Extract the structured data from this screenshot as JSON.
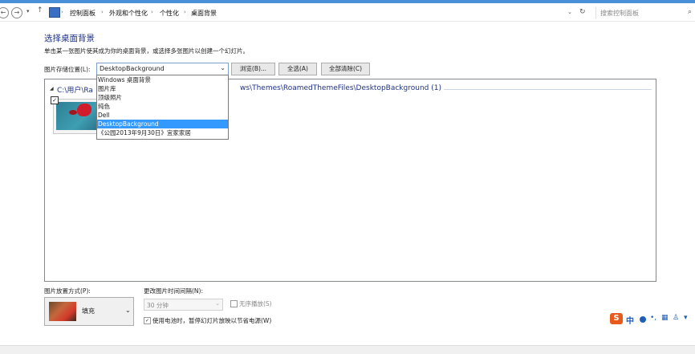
{
  "colors": {
    "accent": "#1e3287",
    "selection": "#3399ff",
    "title_strip": "#4a90d9"
  },
  "address_bar": {
    "back_icon": "back-arrow-icon",
    "forward_icon": "forward-arrow-icon",
    "dropdown_icon": "chevron-down-icon",
    "up_icon": "up-arrow-icon",
    "breadcrumbs": [
      "控制面板",
      "外观和个性化",
      "个性化",
      "桌面背景"
    ],
    "refresh_icon": "refresh-icon",
    "search_placeholder": "搜索控制面板"
  },
  "main": {
    "title": "选择桌面背景",
    "subtitle": "单击某一张图片使其成为你的桌面背景，或选择多张图片以创建一个幻灯片。",
    "location_label": "图片存储位置(L):",
    "location_value": "DesktopBackground",
    "buttons": {
      "browse": "浏览(B)...",
      "select_all": "全选(A)",
      "clear_all": "全部清除(C)"
    },
    "dropdown_options": [
      "Windows 桌面背景",
      "图片库",
      "顶级照片",
      "纯色",
      "Dell",
      "DesktopBackground",
      "《公园2013年9月30日》宜家家居"
    ],
    "dropdown_selected_index": 5,
    "group_path_left": "C:\\用户\\Ra",
    "group_path_right": "ws\\Themes\\RoamedThemeFiles\\DesktopBackground (1)",
    "thumbnail_checked": "✓"
  },
  "bottom": {
    "position_label": "图片放置方式(P):",
    "position_value": "填充",
    "interval_label": "更改图片时间间隔(N):",
    "interval_value": "30 分钟",
    "shuffle_label": "无序播放(S)",
    "battery_label": "使用电池时，暂停幻灯片放映以节省电源(W)",
    "battery_checked": "✓"
  },
  "ime": {
    "logo": "S",
    "lang": "中"
  }
}
